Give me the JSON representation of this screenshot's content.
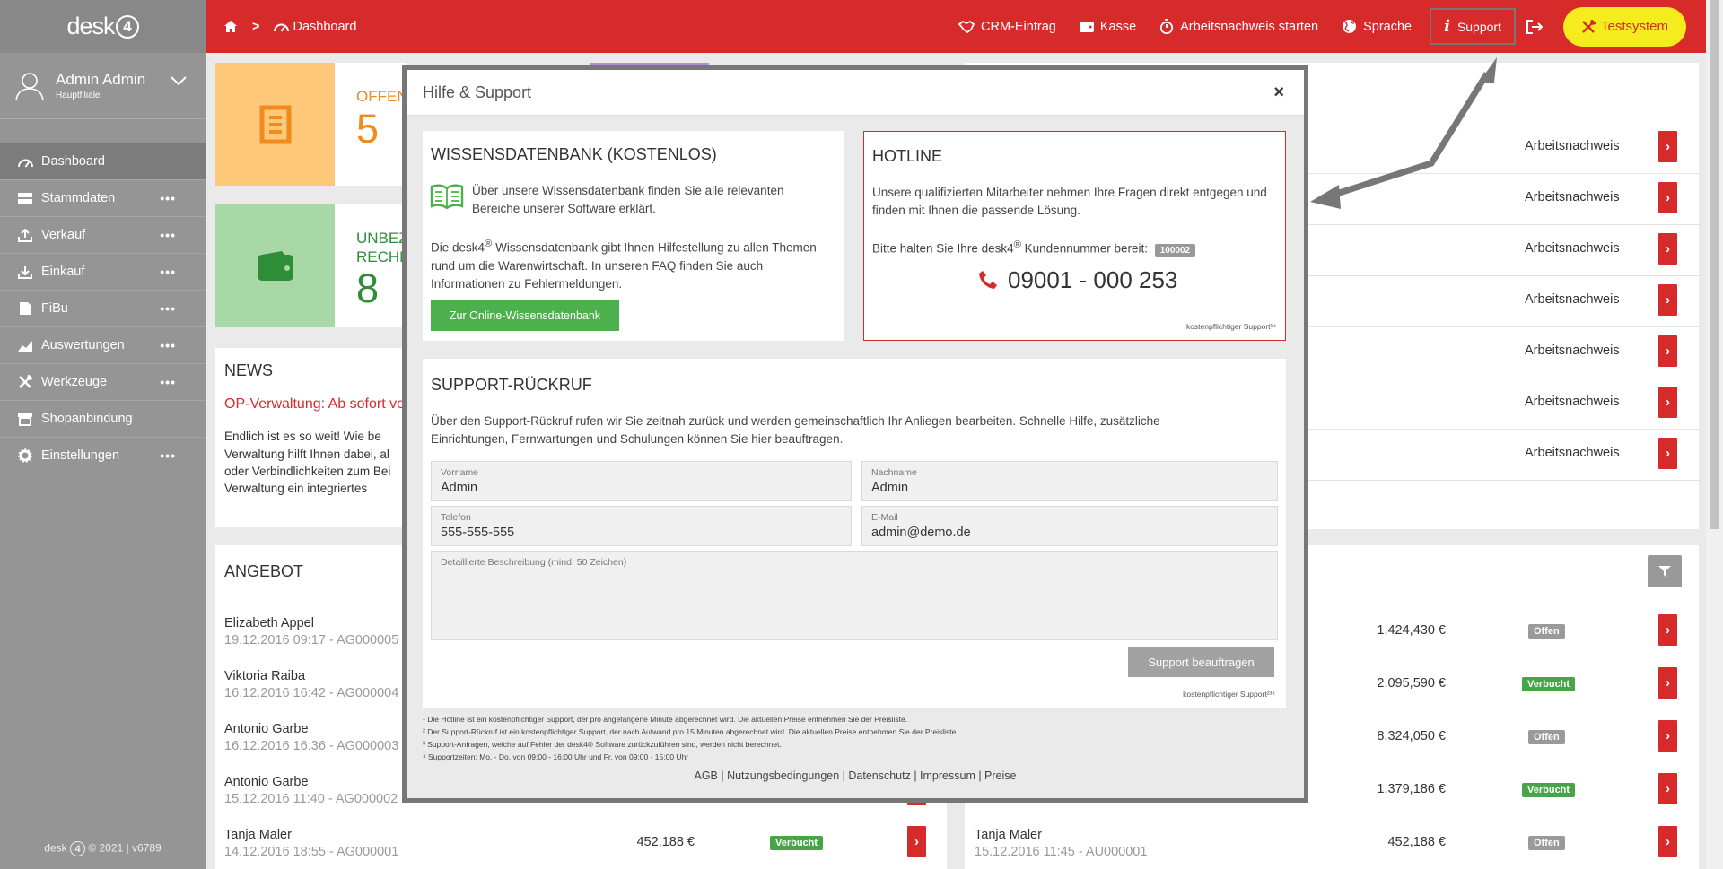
{
  "app": {
    "logo": "desk",
    "logo_num": "4",
    "footer_brand": "desk",
    "footer_rest": "© 2021 | v6789"
  },
  "user": {
    "name": "Admin Admin",
    "branch": "Hauptfiliale"
  },
  "sidebar": {
    "items": [
      {
        "label": "Dashboard",
        "icon": "gauge-icon",
        "dots": ""
      },
      {
        "label": "Stammdaten",
        "icon": "stack-icon",
        "dots": "•••"
      },
      {
        "label": "Verkauf",
        "icon": "upload-icon",
        "dots": "•••"
      },
      {
        "label": "Einkauf",
        "icon": "download-icon",
        "dots": "•••"
      },
      {
        "label": "FiBu",
        "icon": "book-icon",
        "dots": "•••"
      },
      {
        "label": "Auswertungen",
        "icon": "chart-icon",
        "dots": "•••"
      },
      {
        "label": "Werkzeuge",
        "icon": "tools-icon",
        "dots": "•••"
      },
      {
        "label": "Shopanbindung",
        "icon": "shop-icon",
        "dots": ""
      },
      {
        "label": "Einstellungen",
        "icon": "gear-icon",
        "dots": "•••"
      }
    ]
  },
  "topbar": {
    "breadcrumb_sep": ">",
    "breadcrumb": "Dashboard",
    "crm": "CRM-Eintrag",
    "kasse": "Kasse",
    "arbeitsnachweis": "Arbeitsnachweis starten",
    "sprache": "Sprache",
    "support": "Support",
    "testsystem": "Testsystem"
  },
  "dashboard": {
    "tile1": {
      "label": "OFFEN",
      "value": "5"
    },
    "tile2": {
      "label": "UNBEZ",
      "label2": "RECHN",
      "value": "8"
    },
    "news_title": "NEWS",
    "news_headline": "OP-Verwaltung: Ab sofort ve",
    "news_lines": [
      "Endlich ist es so weit! Wie be",
      "Verwaltung hilft Ihnen dabei, al",
      "oder Verbindlichkeiten zum Bei",
      "Verwaltung ein integriertes"
    ],
    "right_rows": [
      "Arbeitsnachweis",
      "Arbeitsnachweis",
      "Arbeitsnachweis",
      "Arbeitsnachweis",
      "Arbeitsnachweis",
      "Arbeitsnachweis",
      "Arbeitsnachweis"
    ],
    "angebot_title": "ANGEBOT",
    "angebot": [
      {
        "name": "Elizabeth Appel",
        "sub": "19.12.2016 09:17 - AG000005"
      },
      {
        "name": "Viktoria Raiba",
        "sub": "16.12.2016 16:42 - AG000004"
      },
      {
        "name": "Antonio Garbe",
        "sub": "16.12.2016 16:36 - AG000003"
      },
      {
        "name": "Antonio Garbe",
        "sub": "15.12.2016 11:40 - AG000002"
      },
      {
        "name": "Tanja Maler",
        "sub": "14.12.2016 18:55 - AG000001",
        "amount": "452,188 €",
        "status": "Verbucht"
      }
    ],
    "auftrag": [
      {
        "amount": "1.424,430 €",
        "status": "Offen"
      },
      {
        "amount": "2.095,590 €",
        "status": "Verbucht"
      },
      {
        "amount": "8.324,050 €",
        "status": "Offen"
      },
      {
        "amount": "1.379,186 €",
        "status": "Verbucht"
      },
      {
        "name": "Tanja Maler",
        "sub": "15.12.2016 11:45 - AU000001",
        "amount": "452,188 €",
        "status": "Offen"
      }
    ]
  },
  "modal": {
    "title": "Hilfe & Support",
    "close": "×",
    "wissen": {
      "title": "WISSENSDATENBANK (KOSTENLOS)",
      "intro": "Über unsere Wissensdatenbank finden Sie alle relevanten Bereiche unserer Software erklärt.",
      "text_a": "Die desk4",
      "text_sup": "®",
      "text_b": " Wissensdatenbank gibt Ihnen Hilfestellung zu allen Themen rund um die Warenwirtschaft. In unseren FAQ finden Sie auch Informationen zu Fehlermeldungen.",
      "button": "Zur Online-Wissensdatenbank"
    },
    "hotline": {
      "title": "HOTLINE",
      "text": "Unsere qualifizierten Mitarbeiter nehmen Ihre Fragen direkt entgegen und finden mit Ihnen die passende Lösung.",
      "keep_a": "Bitte halten Sie Ihre desk4",
      "keep_sup": "®",
      "keep_b": " Kundennummer bereit:",
      "customer_no": "100002",
      "phone": "09001 - 000 253",
      "note": "kostenpflichtiger Support¹⁴"
    },
    "rueckruf": {
      "title": "SUPPORT-RÜCKRUF",
      "text": "Über den Support-Rückruf rufen wir Sie zeitnah zurück und werden gemeinschaftlich Ihr Anliegen bearbeiten. Schnelle Hilfe, zusätzliche Einrichtungen, Fernwartungen und Schulungen können Sie hier beauftragen.",
      "vorname_label": "Vorname",
      "vorname": "Admin",
      "nachname_label": "Nachname",
      "nachname": "Admin",
      "telefon_label": "Telefon",
      "telefon": "555-555-555",
      "email_label": "E-Mail",
      "email": "admin@demo.de",
      "beschreibung_label": "Detaillierte Beschreibung (mind. 50 Zeichen)",
      "button": "Support beauftragen",
      "note": "kostenpflichtiger Support²³⁴"
    },
    "footnotes": [
      "¹ Die Hotline ist ein kostenpflichtiger Support, der pro angefangene Minute abgerechnet wird. Die aktuellen Preise entnehmen Sie der Preisliste.",
      "² Der Support-Rückruf ist ein kostenpflichtiger Support, der nach Aufwand pro 15 Minuten abgerechnet wird. Die aktuellen Preise entnehmen Sie der Preisliste.",
      "³ Support-Anfragen, welche auf Fehler der desk4® Software zurückzuführen sind, werden nicht berechnet.",
      "⁴ Supportzeiten: Mo. - Do. von 09:00 - 16:00 Uhr und Fr. von 09:00 - 15:00 Uhr"
    ],
    "links": "AGB | Nutzungsbedingungen | Datenschutz | Impressum | Preise"
  },
  "colors": {
    "brand_red": "#d72b2b",
    "tile_orange": "#fec87a",
    "tile_green": "#a8d8a6",
    "btn_green": "#4cb04c",
    "test_yellow": "#f4ec1e"
  }
}
